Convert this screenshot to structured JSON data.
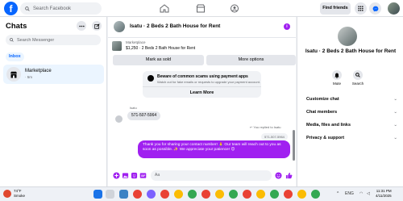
{
  "topnav": {
    "logo": "f",
    "search_placeholder": "Search Facebook",
    "find_friends": "Find friends"
  },
  "sidebar": {
    "title": "Chats",
    "search_placeholder": "Search Messenger",
    "inbox_label": "Inbox",
    "conversations": [
      {
        "name": "Marketplace",
        "time": "· 5m"
      }
    ]
  },
  "chat": {
    "title": "Isatu · 2 Beds 2 Bath House for Rent",
    "listing_tag": "Marketplace",
    "listing_price": "$1,250 · 2 Beds 2 Bath House for Rent",
    "mark_sold": "Mark as sold",
    "more_options": "More options",
    "scam_title": "Beware of common scams using payment apps",
    "scam_desc": "Watch out for fake emails or requests to upgrade your payment account.",
    "learn_more": "Learn More",
    "sender_name": "Isatu",
    "their_message": "571-507-5964",
    "replied_label": "You replied to Isatu",
    "quoted_message": "571-507-5964",
    "my_message": "Thank you for sharing your contact number! 🙏 Our team will reach out to you as soon as possible. ✨ We appreciate your patience! 😊",
    "composer_placeholder": "Aa"
  },
  "right_panel": {
    "title": "Isatu · 2 Beds 2 Bath House for Rent",
    "mute_label": "Mute",
    "search_label": "Search",
    "sections": [
      "Customize chat",
      "Chat members",
      "Media, files and links",
      "Privacy & support"
    ]
  },
  "taskbar": {
    "temperature": "74°F",
    "weather": "Smoke",
    "time": "11:31 PM",
    "date": "4/11/2025",
    "lang": "ENG"
  },
  "colors": {
    "accent": "#a020f0",
    "facebook_blue": "#0866ff"
  }
}
